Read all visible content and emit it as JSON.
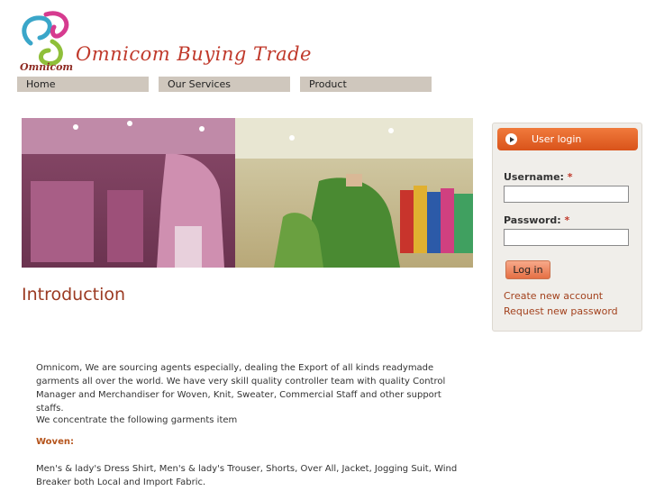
{
  "header": {
    "logo_small": "Omnicom",
    "brand": "Omnicom Buying Trade"
  },
  "nav": {
    "items": [
      {
        "label": "Home"
      },
      {
        "label": "Our Services"
      },
      {
        "label": "Product"
      }
    ]
  },
  "main": {
    "title": "Introduction",
    "paragraph1": "Omnicom, We are sourcing agents especially, dealing the Export of all kinds readymade garments all over the world. We have very skill quality controller team with quality Control Manager and Merchandiser for Woven, Knit, Sweater, Commercial Staff and other support staffs.",
    "paragraph2": "We concentrate the following garments item",
    "woven_heading": "Woven:",
    "paragraph3": "Men's & lady's Dress Shirt, Men's & lady's Trouser, Shorts, Over All, Jacket, Jogging Suit, Wind Breaker both Local and Import Fabric."
  },
  "login": {
    "header": "User login",
    "username_label": "Username:",
    "password_label": "Password:",
    "required_mark": "*",
    "username_value": "",
    "password_value": "",
    "button": "Log in",
    "create_account": "Create new account",
    "request_password": "Request new password"
  },
  "colors": {
    "accent": "#d9531a",
    "nav_bg": "#cfc7bd",
    "title": "#9b3a22"
  }
}
